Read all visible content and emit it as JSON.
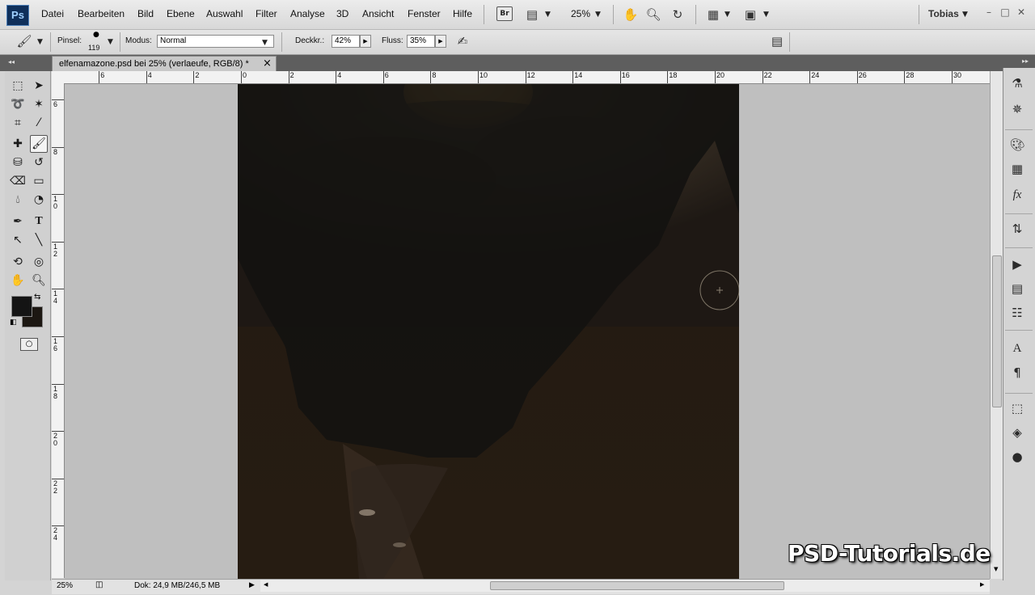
{
  "app": {
    "logo": "Ps",
    "user": "Tobias",
    "zoom": "25%"
  },
  "menu": [
    "Datei",
    "Bearbeiten",
    "Bild",
    "Ebene",
    "Auswahl",
    "Filter",
    "Analyse",
    "3D",
    "Ansicht",
    "Fenster",
    "Hilfe"
  ],
  "toolbar": {
    "bridge": "Br"
  },
  "options": {
    "brush_label": "Pinsel:",
    "brush_size": "119",
    "mode_label": "Modus:",
    "mode_value": "Normal",
    "opacity_label": "Deckkr.:",
    "opacity_value": "42%",
    "flow_label": "Fluss:",
    "flow_value": "35%"
  },
  "document": {
    "tab_title": "elfenamazone.psd bei 25% (verlaeufe, RGB/8) *",
    "close": "×"
  },
  "ruler_top": [
    "6",
    "4",
    "2",
    "0",
    "2",
    "4",
    "6",
    "8",
    "10",
    "12",
    "14",
    "16",
    "18",
    "20",
    "22",
    "24",
    "26",
    "28",
    "30"
  ],
  "ruler_left": [
    "6",
    "8",
    "1 0",
    "1 2",
    "1 4",
    "1 6",
    "1 8",
    "2 0",
    "2 2",
    "2 4"
  ],
  "status": {
    "zoom": "25%",
    "doc_info": "Dok: 24,9 MB/246,5 MB"
  },
  "watermark": "PSD-Tutorials.de",
  "colors": {
    "foreground": "#141414",
    "background": "#1c1712",
    "accent": "#0f2f5a"
  }
}
